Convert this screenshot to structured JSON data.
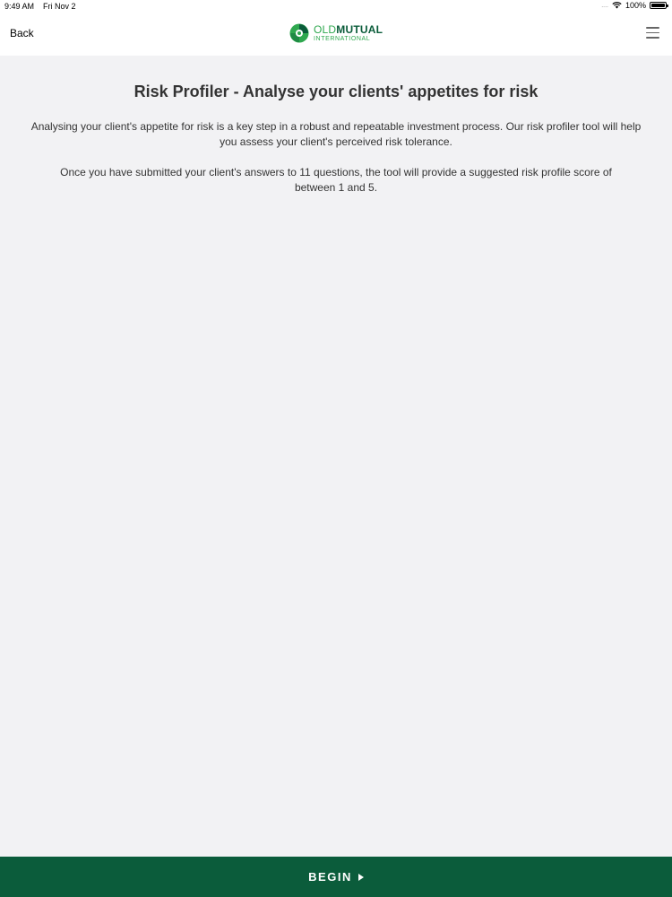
{
  "status_bar": {
    "time": "9:49 AM",
    "date": "Fri Nov 2",
    "signal": "....",
    "battery": "100%"
  },
  "nav": {
    "back_label": "Back",
    "logo_line1_a": "OLD",
    "logo_line1_b": "MUTUAL",
    "logo_line2": "INTERNATIONAL",
    "menu_icon": "hamburger-menu-icon"
  },
  "main": {
    "title": "Risk Profiler - Analyse your clients' appetites for risk",
    "paragraph_1": "Analysing your client's appetite for risk is a key step in a robust and repeatable investment process. Our risk profiler tool will help you assess your client's perceived risk tolerance.",
    "paragraph_2": "Once you have submitted your client's answers to 11 questions, the tool will provide a suggested risk profile score of between 1 and 5."
  },
  "footer": {
    "begin_label": "BEGIN",
    "begin_icon": "play-arrow-icon"
  },
  "colors": {
    "brand_dark_green": "#0b5c3b",
    "brand_light_green": "#2fa84f",
    "background": "#f2f2f4"
  }
}
